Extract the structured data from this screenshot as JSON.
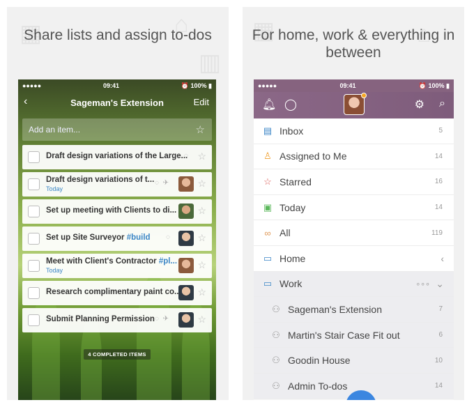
{
  "left": {
    "headline": "Share lists and assign to-dos",
    "status": {
      "signal": "●●●●● ",
      "time": "09:41",
      "battery": "100%"
    },
    "nav": {
      "back": "‹",
      "title": "Sageman's Extension",
      "edit": "Edit"
    },
    "add_placeholder": "Add an item...",
    "tasks": [
      {
        "title": "Draft design variations of the Large...",
        "tag": "",
        "due": ""
      },
      {
        "title": "Draft design variations of t...",
        "tag": "",
        "due": "Today"
      },
      {
        "title": "Set up meeting with Clients to di...",
        "tag": "",
        "due": ""
      },
      {
        "title": "Set up Site Surveyor ",
        "tag": "#build",
        "due": ""
      },
      {
        "title": "Meet with Client's Contractor ",
        "tag": "#pl...",
        "due": "Today"
      },
      {
        "title": "Research complimentary paint co...",
        "tag": "",
        "due": ""
      },
      {
        "title": "Submit Planning Permission",
        "tag": "",
        "due": ""
      }
    ],
    "completed": "4 COMPLETED ITEMS"
  },
  "right": {
    "headline": "For home, work & everything in between",
    "status": {
      "signal": "●●●●● ",
      "time": "09:41",
      "battery": "100%"
    },
    "menu": [
      {
        "label": "Inbox",
        "count": "5",
        "icon": "inbox-icon"
      },
      {
        "label": "Assigned to Me",
        "count": "14",
        "icon": "person-icon"
      },
      {
        "label": "Starred",
        "count": "16",
        "icon": "star-icon"
      },
      {
        "label": "Today",
        "count": "14",
        "icon": "calendar-icon"
      },
      {
        "label": "All",
        "count": "119",
        "icon": "infinity-icon"
      },
      {
        "label": "Home",
        "count": "",
        "icon": "folder-icon"
      },
      {
        "label": "Work",
        "count": "",
        "icon": "folder-icon"
      },
      {
        "label": "Sageman's Extension",
        "count": "7",
        "icon": "shared-list-icon"
      },
      {
        "label": "Martin's Stair Case Fit out",
        "count": "6",
        "icon": "shared-list-icon"
      },
      {
        "label": "Goodin House",
        "count": "10",
        "icon": "shared-list-icon"
      },
      {
        "label": "Admin To-dos",
        "count": "14",
        "icon": "shared-list-icon"
      }
    ]
  },
  "colors": {
    "accent_blue": "#3b86c6",
    "nav_purple": "#8b6887",
    "starred_red": "#d9534f",
    "today_green": "#5cb85c"
  }
}
